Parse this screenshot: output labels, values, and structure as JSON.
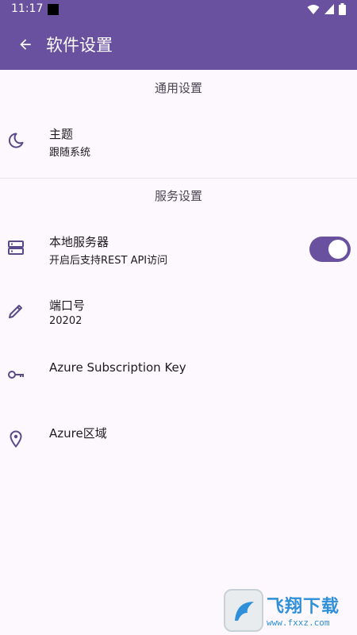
{
  "status_bar": {
    "time": "11:17",
    "icons": [
      "wifi-icon",
      "signal-icon",
      "battery-icon"
    ]
  },
  "app_bar": {
    "title": "软件设置",
    "back_icon": "arrow-left-icon",
    "color": "#6a51a0"
  },
  "sections": {
    "general": {
      "header": "通用设置",
      "items": {
        "theme": {
          "icon": "moon-icon",
          "title": "主题",
          "subtitle": "跟随系统"
        }
      }
    },
    "service": {
      "header": "服务设置",
      "items": {
        "local_server": {
          "icon": "server-icon",
          "title": "本地服务器",
          "subtitle": "开启后支持REST API访问",
          "enabled": true
        },
        "port": {
          "icon": "pencil-icon",
          "title": "端口号",
          "subtitle": "20202"
        },
        "azure_key": {
          "icon": "key-icon",
          "title": "Azure Subscription Key"
        },
        "azure_region": {
          "icon": "location-pin-icon",
          "title": "Azure区域"
        }
      }
    }
  },
  "colors": {
    "accent": "#6a51a0",
    "background": "#fdf8fd",
    "text": "#1c1b1f",
    "icon": "#5b4a8a"
  },
  "watermark": {
    "brand": "飞翔下载",
    "url": "www.fxxz.com"
  }
}
